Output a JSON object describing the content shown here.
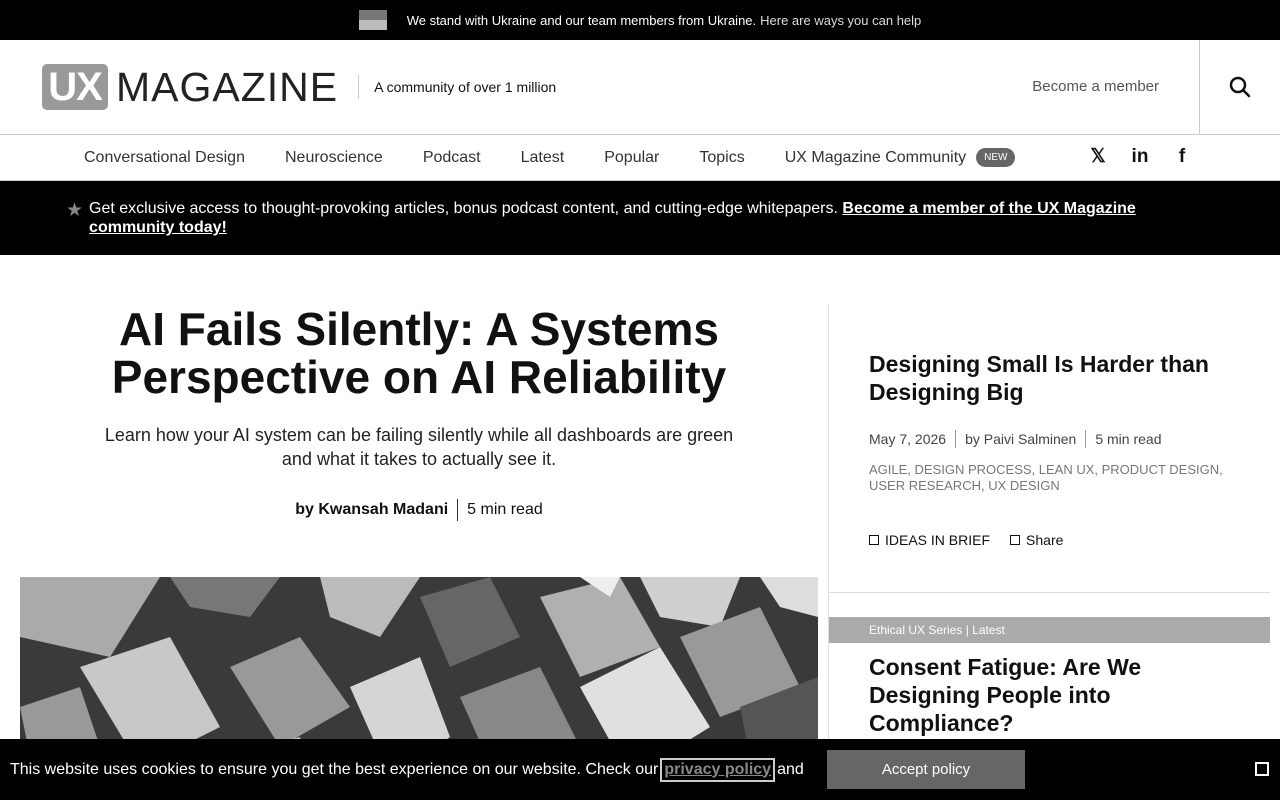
{
  "banner": {
    "ukraine_text": "We stand with Ukraine and our team members from Ukraine.",
    "ukraine_link": "Here are ways you can help"
  },
  "header": {
    "logo_box": "UX",
    "logo_word": "MAGAZINE",
    "tagline": "A community of over 1 million",
    "member_link": "Become a member",
    "search_icon": "search-icon"
  },
  "nav": {
    "items": [
      "Conversational Design",
      "Neuroscience",
      "Podcast",
      "Latest",
      "Popular",
      "Topics",
      "UX Magazine Community"
    ],
    "new_badge": "NEW",
    "social": [
      "𝕏",
      "in",
      "f"
    ]
  },
  "promo": {
    "text": "Get exclusive access to thought-provoking articles, bonus podcast content, and cutting-edge whitepapers.",
    "link": "Become a member of the UX Magazine community today!"
  },
  "hero": {
    "title": "AI Fails Silently: A Systems Perspective on AI Reliability",
    "subtitle": "Learn how your AI system can be failing silently while all dashboards are green and what it takes to actually see it.",
    "author": "by Kwansah Madani",
    "read_time": "5 min read"
  },
  "side_article_1": {
    "title": "Designing Small Is Harder than Designing Big",
    "date": "May 7, 2026",
    "author": "by Paivi Salminen",
    "read_time": "5 min read",
    "tags": "AGILE, DESIGN PROCESS, LEAN UX, PRODUCT DESIGN, USER RESEARCH, UX DESIGN",
    "action_1": "IDEAS IN BRIEF",
    "action_2": "Share"
  },
  "side_article_2": {
    "series": "Ethical UX Series | Latest",
    "title": "Consent Fatigue: Are We Designing People into Compliance?"
  },
  "cookie": {
    "text": "This website uses cookies to ensure you get the best experience on our website. Check our",
    "policy_link": "privacy policy",
    "and": "and",
    "accept": "Accept policy"
  }
}
